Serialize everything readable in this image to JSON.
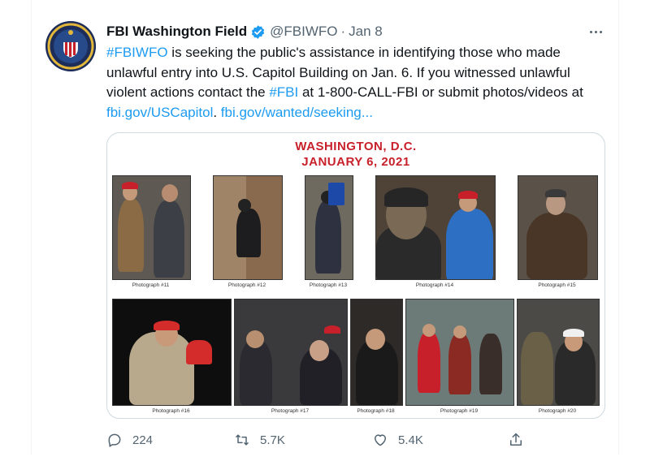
{
  "tweet": {
    "author_name": "FBI Washington Field",
    "handle": "@FBIWFO",
    "separator": "·",
    "date": "Jan 8",
    "text_parts": [
      {
        "text": "#FBIWFO",
        "link": true
      },
      {
        "text": " is seeking the public's assistance in identifying those who made unlawful entry into U.S. Capitol Building on Jan. 6. If you witnessed unlawful violent actions contact the ",
        "link": false
      },
      {
        "text": "#FBI",
        "link": true
      },
      {
        "text": " at 1-800-CALL-FBI or submit photos/videos at ",
        "link": false
      },
      {
        "text": "fbi.gov/USCapitol",
        "link": true
      },
      {
        "text": ". ",
        "link": false
      },
      {
        "text": "fbi.gov/wanted/seeking...",
        "link": true
      }
    ]
  },
  "media": {
    "title_line1": "WASHINGTON, D.C.",
    "title_line2": "JANUARY 6, 2021",
    "captions": [
      "Photograph #11",
      "Photograph #12",
      "Photograph #13",
      "Photograph #14",
      "Photograph #15",
      "Photograph #16",
      "Photograph #17",
      "Photograph #18",
      "Photograph #19",
      "Photograph #20"
    ]
  },
  "actions": {
    "replies": "224",
    "retweets": "5.7K",
    "likes": "5.4K"
  },
  "icons": {
    "avatar": "fbi-seal-icon",
    "verified": "verified-badge-icon",
    "more": "more-options-icon",
    "reply": "reply-icon",
    "retweet": "retweet-icon",
    "like": "heart-icon",
    "share": "share-icon"
  },
  "colors": {
    "link": "#1d9bf0",
    "verified": "#1d9bf0",
    "poster_title": "#c8202a",
    "muted": "#536471"
  }
}
